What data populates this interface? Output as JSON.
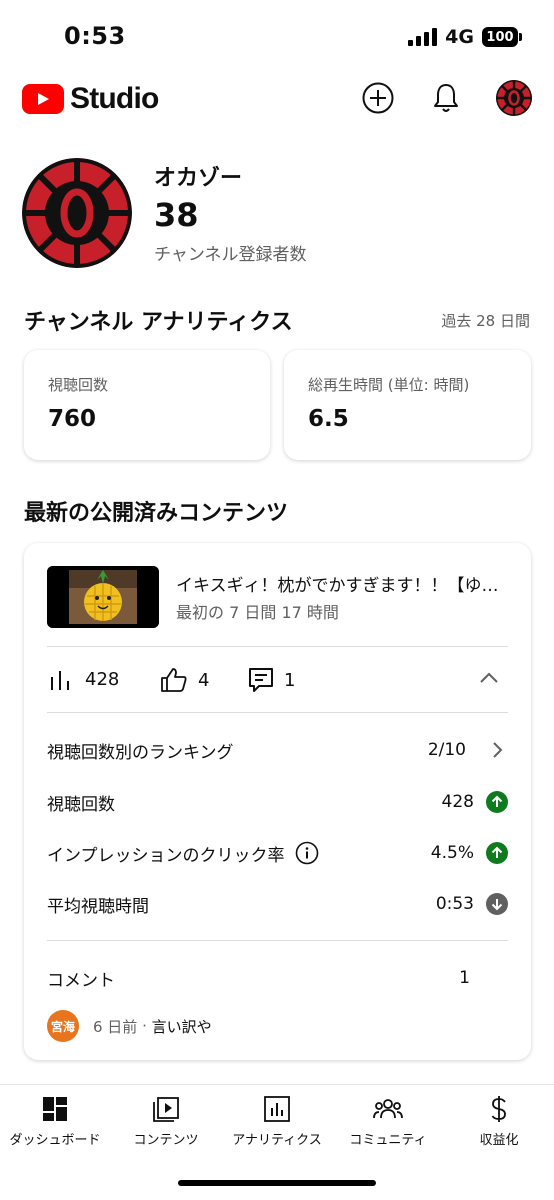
{
  "status_bar": {
    "time": "0:53",
    "network": "4G",
    "battery": "100"
  },
  "header": {
    "app_name": "Studio",
    "icons": {
      "create": "plus-circle-icon",
      "notifications": "bell-icon",
      "account": "avatar"
    }
  },
  "channel": {
    "name": "オカゾー",
    "subscribers": "38",
    "subscribers_label": "チャンネル登録者数"
  },
  "analytics": {
    "title": "チャンネル アナリティクス",
    "range": "過去 28 日間",
    "cards": [
      {
        "label": "視聴回数",
        "value": "760"
      },
      {
        "label": "総再生時間 (単位: 時間)",
        "value": "6.5"
      }
    ]
  },
  "latest": {
    "title": "最新の公開済みコンテンツ",
    "video": {
      "title": "イキスギィ！枕がでかすぎます！！【ゆっくり実況】",
      "subtitle": "最初の 7 日間 17 時間"
    },
    "metrics": {
      "views": "428",
      "likes": "4",
      "comments": "1"
    },
    "rows": [
      {
        "label": "視聴回数別のランキング",
        "value": "2/10",
        "indicator": "chevron"
      },
      {
        "label": "視聴回数",
        "value": "428",
        "indicator": "up"
      },
      {
        "label": "インプレッションのクリック率",
        "value": "4.5%",
        "indicator": "up"
      },
      {
        "label": "平均視聴時間",
        "value": "0:53",
        "indicator": "down"
      }
    ],
    "comments_label": "コメント",
    "comments_count": "1",
    "comment": {
      "author_badge": "宮海",
      "time": "6 日前",
      "separator": " · ",
      "text": "言い訳や"
    }
  },
  "nav": {
    "items": [
      {
        "label": "ダッシュボード",
        "icon": "dashboard-icon"
      },
      {
        "label": "コンテンツ",
        "icon": "content-icon"
      },
      {
        "label": "アナリティクス",
        "icon": "analytics-icon"
      },
      {
        "label": "コミュニティ",
        "icon": "community-icon"
      },
      {
        "label": "収益化",
        "icon": "dollar-icon"
      }
    ]
  },
  "colors": {
    "brand_red": "#ff0000",
    "up_green": "#0f7b1e",
    "down_grey": "#606060",
    "avatar_red": "#c8202a",
    "comment_avatar": "#e8741d"
  }
}
